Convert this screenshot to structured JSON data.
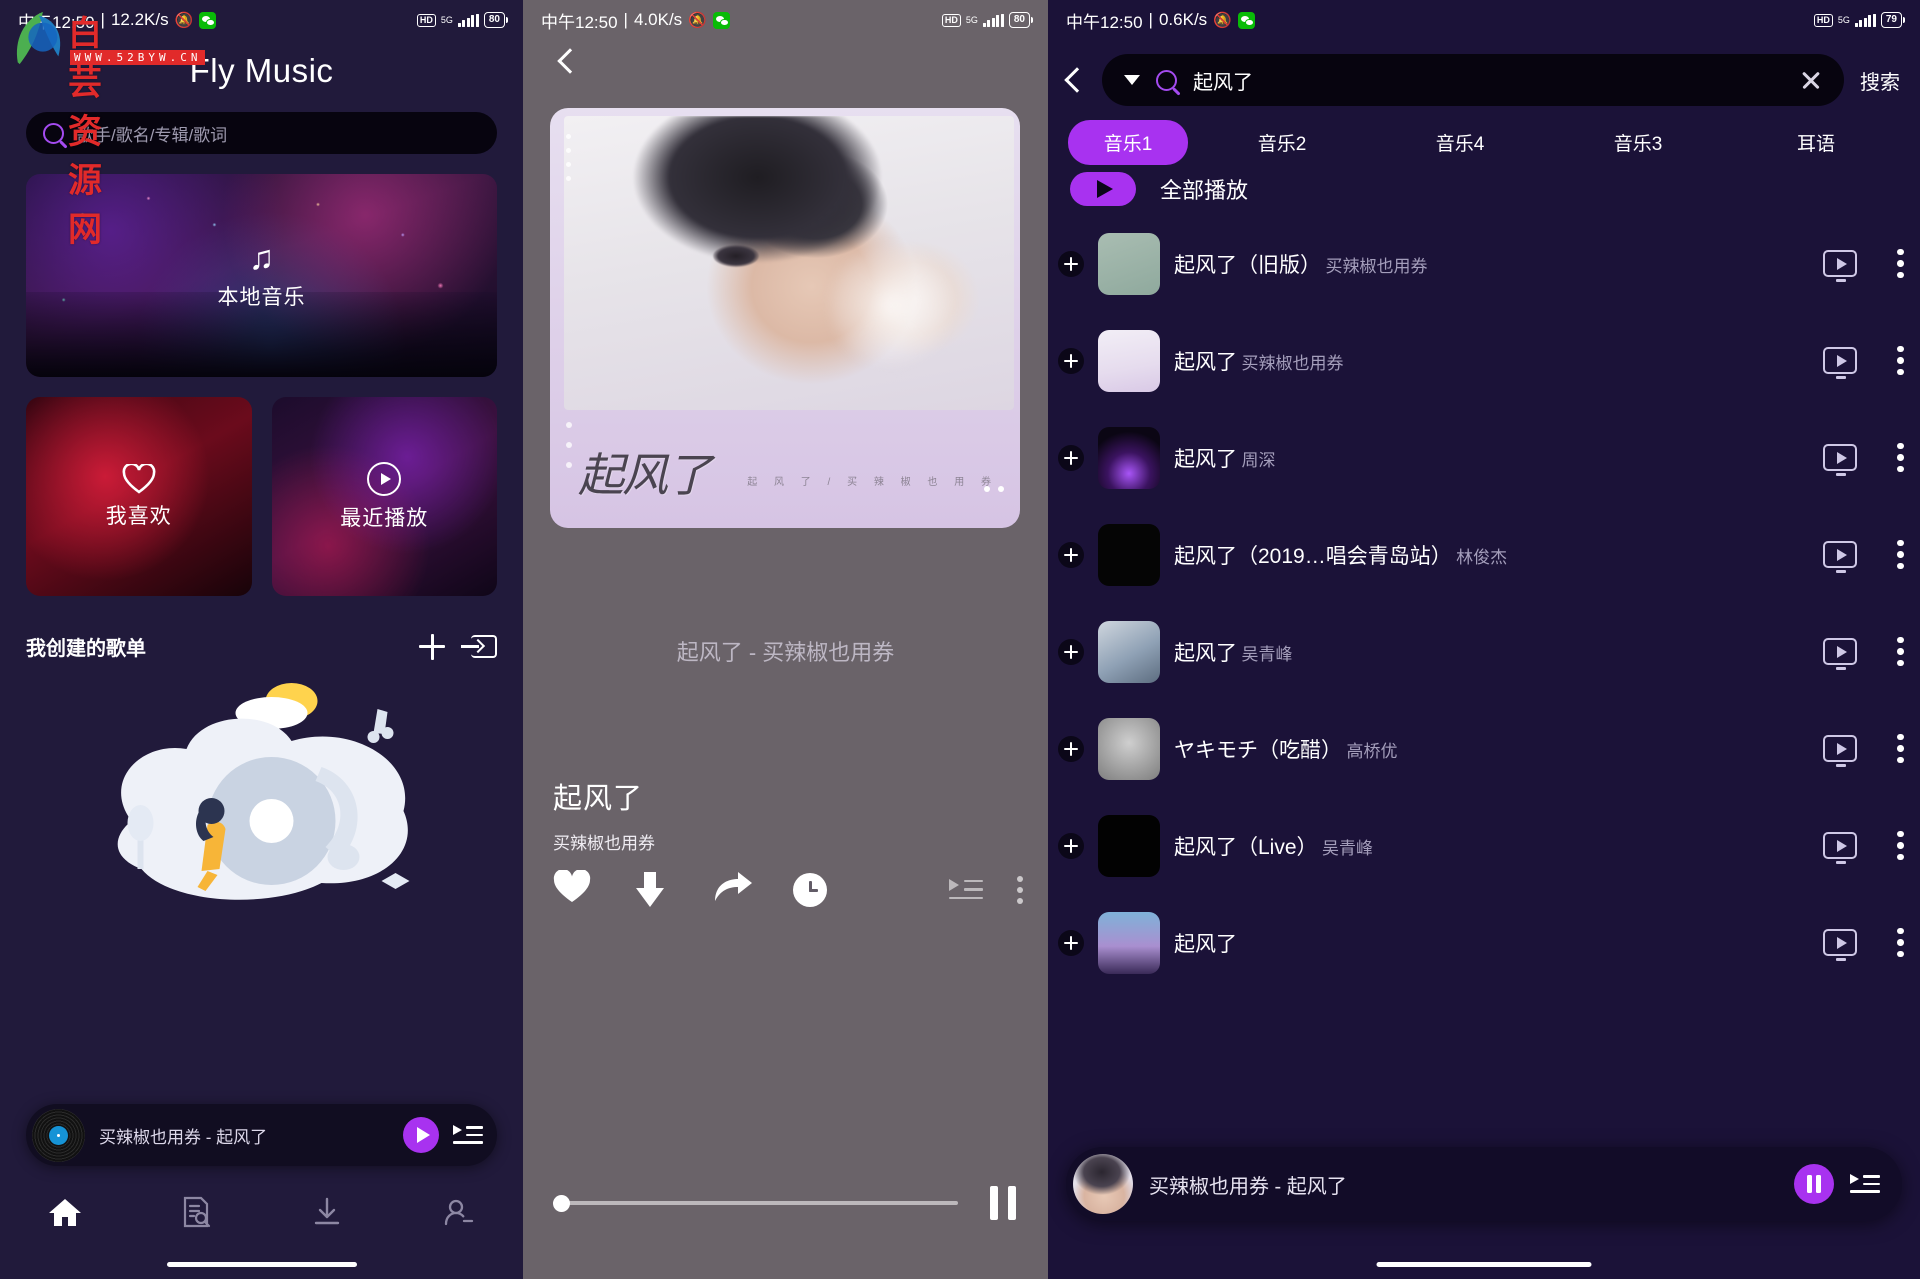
{
  "panel1": {
    "status": {
      "time": "中午12:50",
      "net": "12.2K/s",
      "hd": "HD",
      "gen": "5G",
      "battery": "80",
      "mute_icon": "mute-icon",
      "wechat_icon": "wechat-icon"
    },
    "app_title": "Fly Music",
    "search": {
      "placeholder": "歌手/歌名/专辑/歌词",
      "icon": "search-icon"
    },
    "local_card": {
      "label": "本地音乐",
      "icon": "music-note-icon"
    },
    "cards": [
      {
        "label": "我喜欢",
        "icon": "heart-outline-icon"
      },
      {
        "label": "最近播放",
        "icon": "play-circle-icon"
      }
    ],
    "section": {
      "title": "我创建的歌单",
      "add_icon": "plus-icon",
      "import_icon": "import-icon"
    },
    "empty_art": "empty-playlist-illustration",
    "mini_player": {
      "title": "买辣椒也用券 - 起风了",
      "play_icon": "play-icon",
      "queue_icon": "queue-list-icon",
      "cover": "vinyl-record"
    },
    "tabs": [
      {
        "name": "home",
        "icon": "home-icon",
        "active": true
      },
      {
        "name": "discover",
        "icon": "document-search-icon",
        "active": false
      },
      {
        "name": "downloads",
        "icon": "download-icon",
        "active": false
      },
      {
        "name": "profile",
        "icon": "user-icon",
        "active": false
      }
    ]
  },
  "panel2": {
    "status": {
      "time": "中午12:50",
      "net": "4.0K/s",
      "hd": "HD",
      "gen": "5G",
      "battery": "80"
    },
    "back_icon": "back-chevron-icon",
    "album": {
      "calligraphy": "起风了",
      "caption": "起 风 了 / 买 辣 椒 也 用 券"
    },
    "lyric_line": "起风了 - 买辣椒也用券",
    "song": {
      "title": "起风了",
      "artist": "买辣椒也用券"
    },
    "actions": [
      {
        "name": "favorite",
        "icon": "heart-filled-icon"
      },
      {
        "name": "download",
        "icon": "download-arrow-icon"
      },
      {
        "name": "share",
        "icon": "share-arrow-icon"
      },
      {
        "name": "timer",
        "icon": "clock-icon"
      }
    ],
    "queue_icon": "queue-list-icon",
    "more_icon": "more-vertical-icon",
    "progress": {
      "percent": 1
    },
    "transport": {
      "icon": "pause-icon"
    }
  },
  "panel3": {
    "status": {
      "time": "中午12:50",
      "net": "0.6K/s",
      "hd": "HD",
      "gen": "5G",
      "battery": "79"
    },
    "back_icon": "back-chevron-icon",
    "search": {
      "query": "起风了",
      "icon": "search-icon",
      "clear_icon": "close-icon",
      "dropdown_icon": "caret-down-icon",
      "button": "搜索"
    },
    "tabs": [
      {
        "label": "音乐1",
        "active": true
      },
      {
        "label": "音乐2",
        "active": false
      },
      {
        "label": "音乐4",
        "active": false
      },
      {
        "label": "音乐3",
        "active": false
      },
      {
        "label": "耳语",
        "active": false
      }
    ],
    "play_all": {
      "label": "全部播放",
      "icon": "play-icon"
    },
    "songs": [
      {
        "title": "起风了（旧版）",
        "artist": "买辣椒也用券",
        "cover": "cv-a"
      },
      {
        "title": "起风了",
        "artist": "买辣椒也用券",
        "cover": "cv-b"
      },
      {
        "title": "起风了",
        "artist": "周深",
        "cover": "cv-c"
      },
      {
        "title": "起风了（2019…唱会青岛站）",
        "artist": "林俊杰",
        "cover": "cv-d"
      },
      {
        "title": "起风了",
        "artist": "吴青峰",
        "cover": "cv-e"
      },
      {
        "title": "ヤキモチ（吃醋）",
        "artist": "高桥优",
        "cover": "cv-f"
      },
      {
        "title": "起风了（Live）",
        "artist": "吴青峰",
        "cover": "cv-g"
      },
      {
        "title": "起风了",
        "artist": "",
        "cover": "cv-h"
      }
    ],
    "row_icons": {
      "add": "plus-circle-icon",
      "mv": "mv-icon",
      "more": "more-vertical-icon"
    },
    "mini_player": {
      "title": "买辣椒也用券 - 起风了",
      "pause_icon": "pause-icon",
      "queue_icon": "queue-list-icon"
    }
  },
  "watermark": {
    "text": "白芸资源网",
    "url": "WWW.52BYW.CN"
  },
  "colors": {
    "accent": "#a832f0",
    "bg_dark": "#211a3b",
    "bg_list": "#1b1238",
    "player_bg": "#6a6369"
  }
}
